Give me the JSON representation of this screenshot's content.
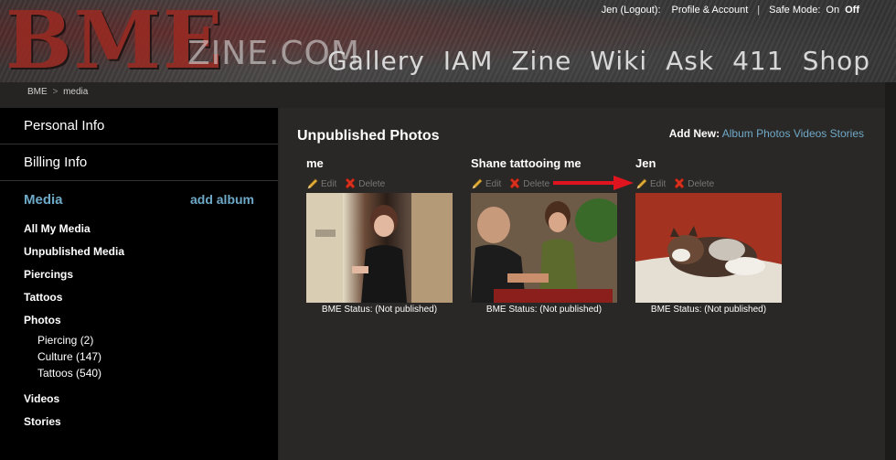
{
  "header": {
    "logo_bme": "BME",
    "logo_zine": "ZINE.COM",
    "account": {
      "user": "Jen (Logout):",
      "profile": "Profile & Account",
      "divider": "|",
      "safe_mode_label": "Safe Mode:",
      "safe_mode_on": "On",
      "safe_mode_off": "Off"
    },
    "nav": [
      "Gallery",
      "IAM",
      "Zine",
      "Wiki",
      "Ask",
      "411",
      "Shop"
    ]
  },
  "breadcrumb": {
    "root": "BME",
    "sep": ">",
    "current": "media"
  },
  "sidebar": {
    "personal_info": "Personal Info",
    "billing_info": "Billing Info",
    "media_title": "Media",
    "add_album": "add album",
    "items": {
      "all_media": "All My Media",
      "unpublished": "Unpublished Media",
      "piercings": "Piercings",
      "tattoos": "Tattoos",
      "photos": "Photos",
      "photos_sub": [
        "Piercing (2)",
        "Culture (147)",
        "Tattoos (540)"
      ],
      "videos": "Videos",
      "stories": "Stories"
    }
  },
  "main": {
    "title": "Unpublished Photos",
    "add_new_label": "Add New:",
    "add_new_links": [
      "Album",
      "Photos",
      "Videos",
      "Stories"
    ],
    "edit_label": "Edit",
    "delete_label": "Delete",
    "cards": [
      {
        "name": "me",
        "status": "BME Status: (Not published)"
      },
      {
        "name": "Shane tattooing me",
        "status": "BME Status: (Not published)"
      },
      {
        "name": "Jen",
        "status": "BME Status: (Not published)"
      }
    ]
  },
  "colors": {
    "accent": "#6fa9c8",
    "arrow": "#e0141e",
    "sidebar_bg": "#000000",
    "main_bg": "#2a2826"
  },
  "icons": [
    "pencil-icon",
    "delete-x-icon",
    "red-arrow-icon"
  ]
}
